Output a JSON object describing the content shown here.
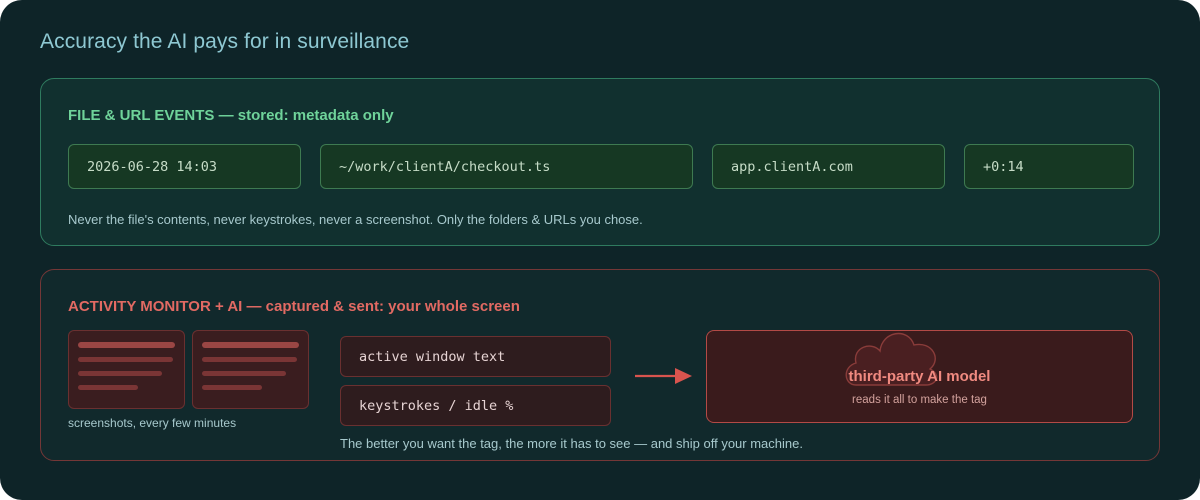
{
  "title": "Accuracy the AI pays for in surveillance",
  "file_url_panel": {
    "heading": "FILE & URL EVENTS — stored: metadata only",
    "fields": {
      "timestamp": "2026-06-28 14:03",
      "path": "~/work/clientA/checkout.ts",
      "host": "app.clientA.com",
      "duration": "+0:14"
    },
    "note": "Never the file's contents, never keystrokes, never a screenshot. Only the folders & URLs you chose."
  },
  "activity_panel": {
    "heading": "ACTIVITY MONITOR + AI — captured & sent: your whole screen",
    "screenshots_caption": "screenshots, every few minutes",
    "captures": [
      "active window text",
      "keystrokes / idle %"
    ],
    "model": {
      "icon": "cloud-icon",
      "title": "third-party AI model",
      "subtitle": "reads it all to make the tag"
    },
    "note": "The better you want the tag, the more it has to see — and ship off your machine."
  },
  "colors": {
    "background": "#0e2428",
    "metadata_accent": "#6fd39a",
    "surveillance_accent": "#e26a63"
  }
}
